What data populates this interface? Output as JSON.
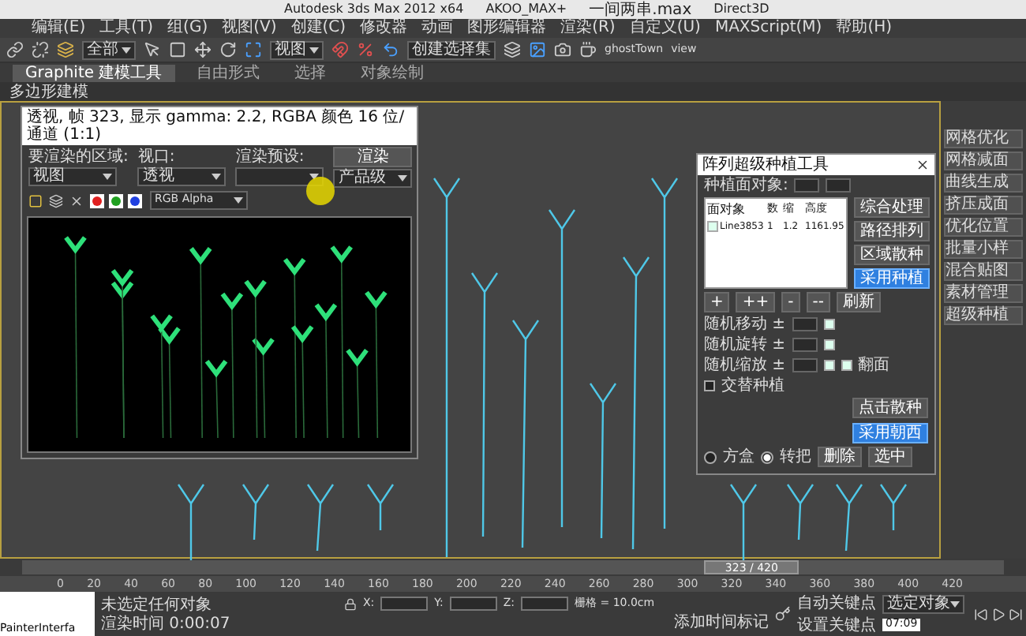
{
  "title_bar": {
    "app": "Autodesk 3ds Max 2012 x64",
    "project": "AKOO_MAX+",
    "file": "一间两串.max",
    "renderer": "Direct3D"
  },
  "menu": [
    "编辑(E)",
    "工具(T)",
    "组(G)",
    "视图(V)",
    "创建(C)",
    "修改器",
    "动画",
    "图形编辑器",
    "渲染(R)",
    "自定义(U)",
    "MAXScript(M)",
    "帮助(H)"
  ],
  "toolbar": {
    "selection_filter": "全部",
    "reference_coord": "视图",
    "named_selection": "创建选择集",
    "labels": [
      "ghostTown",
      "view"
    ]
  },
  "ribbon": {
    "tabs": [
      {
        "label": "Graphite 建模工具",
        "selected": true
      },
      {
        "label": "自由形式",
        "selected": false
      },
      {
        "label": "选择",
        "selected": false
      },
      {
        "label": "对象绘制",
        "selected": false
      }
    ],
    "subtitle": "多边形建模"
  },
  "render_window": {
    "title": "透视, 帧 323, 显示 gamma: 2.2, RGBA 颜色 16 位/通道 (1:1)",
    "region_label": "要渲染的区域:",
    "region": "视图",
    "viewport_label": "视口:",
    "viewport": "透视",
    "preset_label": "渲染预设:",
    "render_button": "渲染",
    "quality": "产品级",
    "channel": "RGB Alpha"
  },
  "tool_panel": {
    "title": "阵列超级种植工具",
    "surface_label": "种植面对象:",
    "columns": [
      "面对象",
      "数",
      "缩",
      "高度"
    ],
    "rows": [
      {
        "checked": true,
        "cells": [
          "Line3853",
          "1",
          "1.2",
          "1161.95"
        ]
      }
    ],
    "side_buttons": [
      {
        "label": "综合处理",
        "primary": false
      },
      {
        "label": "路径排列",
        "primary": false
      },
      {
        "label": "区域散种",
        "primary": false
      },
      {
        "label": "采用种植",
        "primary": true
      }
    ],
    "small_buttons": [
      "+",
      "++",
      "-",
      "--"
    ],
    "refresh": "刷新",
    "random_rows": [
      {
        "label": "随机移动 ±",
        "checked": true
      },
      {
        "label": "随机旋转 ±",
        "checked": true
      },
      {
        "label": "随机缩放 ±",
        "checked": true
      }
    ],
    "flip": {
      "label": "翻面",
      "checked": true
    },
    "alternate": {
      "label": "交替种植",
      "checked": false
    },
    "action_buttons": [
      {
        "label": "点击散种",
        "primary": false
      },
      {
        "label": "采用朝西",
        "primary": true
      }
    ],
    "radios": [
      {
        "label": "方盒",
        "selected": false
      },
      {
        "label": "转把",
        "selected": true
      }
    ],
    "bottom_buttons": [
      "删除",
      "选中"
    ]
  },
  "command_panel": {
    "items": [
      "网格优化",
      "网格减面",
      "曲线生成",
      "挤压成面",
      "优化位置",
      "批量小样",
      "混合贴图",
      "素材管理",
      "超级种植"
    ]
  },
  "timeline": {
    "frame": "323 / 420",
    "level": 0.769,
    "ticks": [
      "0",
      "20",
      "40",
      "60",
      "80",
      "100",
      "120",
      "140",
      "160",
      "180",
      "200",
      "220",
      "240",
      "260",
      "280",
      "300",
      "320",
      "340",
      "360",
      "380",
      "400",
      "420"
    ]
  },
  "status": {
    "script_listener": "PainterInterfa",
    "message": "未选定任何对象",
    "render_time": "渲染时间 0:00:07",
    "add_marker": "添加时间标记",
    "coords": [
      "X:",
      "Y:",
      "Z:"
    ],
    "grid": "栅格 = 10.0cm",
    "auto_key": "自动关键点",
    "key_filter": "选定对象",
    "set_key": "设置关键点",
    "clock": "07:09"
  }
}
